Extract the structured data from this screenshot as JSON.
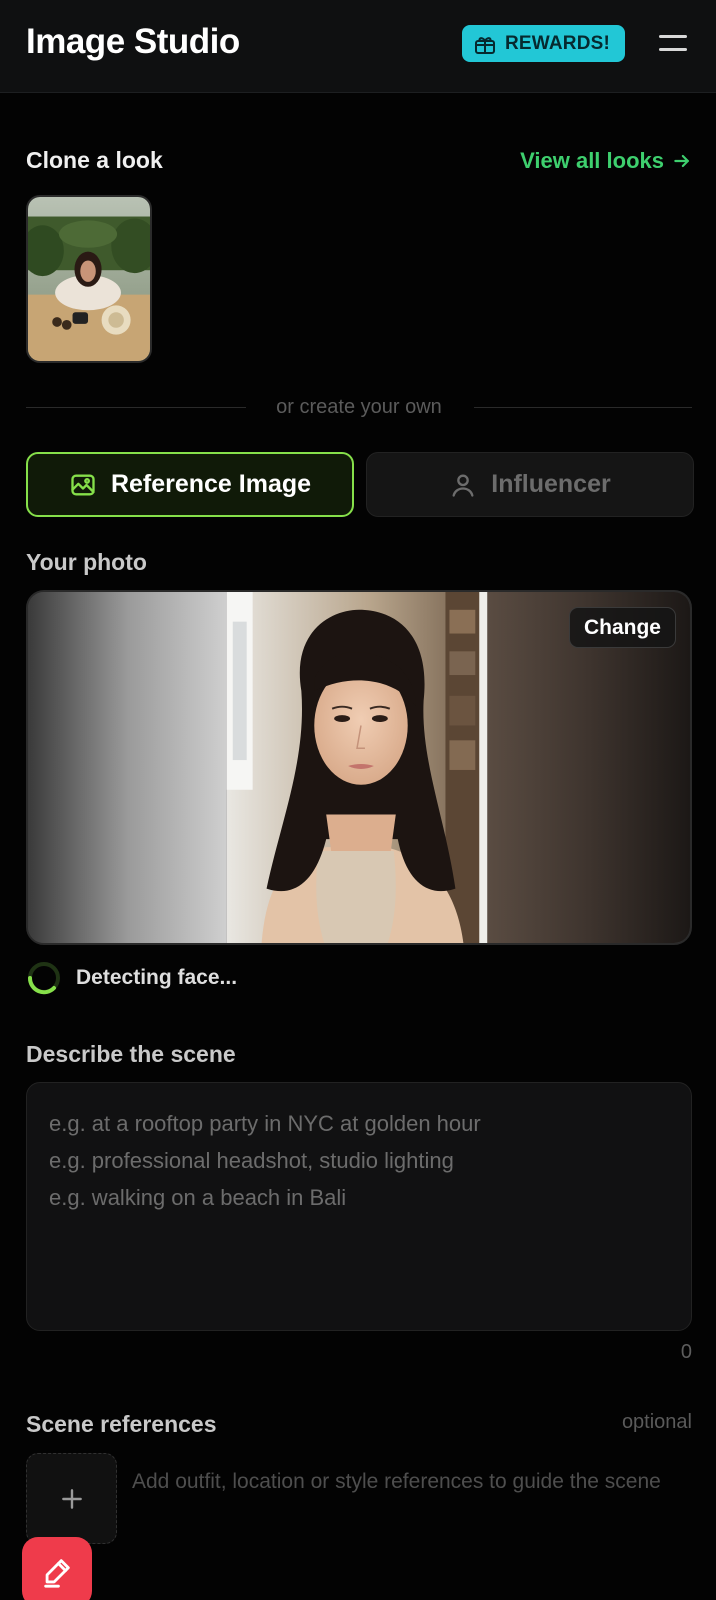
{
  "header": {
    "title": "Image Studio",
    "rewards_label": "REWARDS!",
    "rewards_icon": "gift-box-icon",
    "menu_icon": "hamburger-menu-icon"
  },
  "clone_look": {
    "title": "Clone a look",
    "view_all_label": "View all looks",
    "view_all_icon": "arrow-right-icon"
  },
  "divider_text": "or create your own",
  "mode_tabs": [
    {
      "label": "Reference Image",
      "icon": "image-icon",
      "active": true
    },
    {
      "label": "Influencer",
      "icon": "user-icon",
      "active": false
    }
  ],
  "photo": {
    "title": "Your photo",
    "change_label": "Change",
    "status_text": "Detecting face..."
  },
  "scene": {
    "title": "Describe the scene",
    "placeholder": "e.g. at a rooftop party in NYC at golden hour\ne.g. professional headshot, studio lighting\ne.g. walking on a beach in Bali",
    "char_count": "0"
  },
  "scene_refs": {
    "title": "Scene references",
    "optional_label": "optional",
    "hint": "Add outfit, location or style references to guide the scene",
    "add_icon": "plus-icon"
  },
  "fab_icon": "pen-edit-icon",
  "colors": {
    "accent_green": "#86e04a",
    "link_green": "#3ecf6e",
    "rewards_cyan": "#22c7d6",
    "fab_red": "#ef3b4b"
  }
}
